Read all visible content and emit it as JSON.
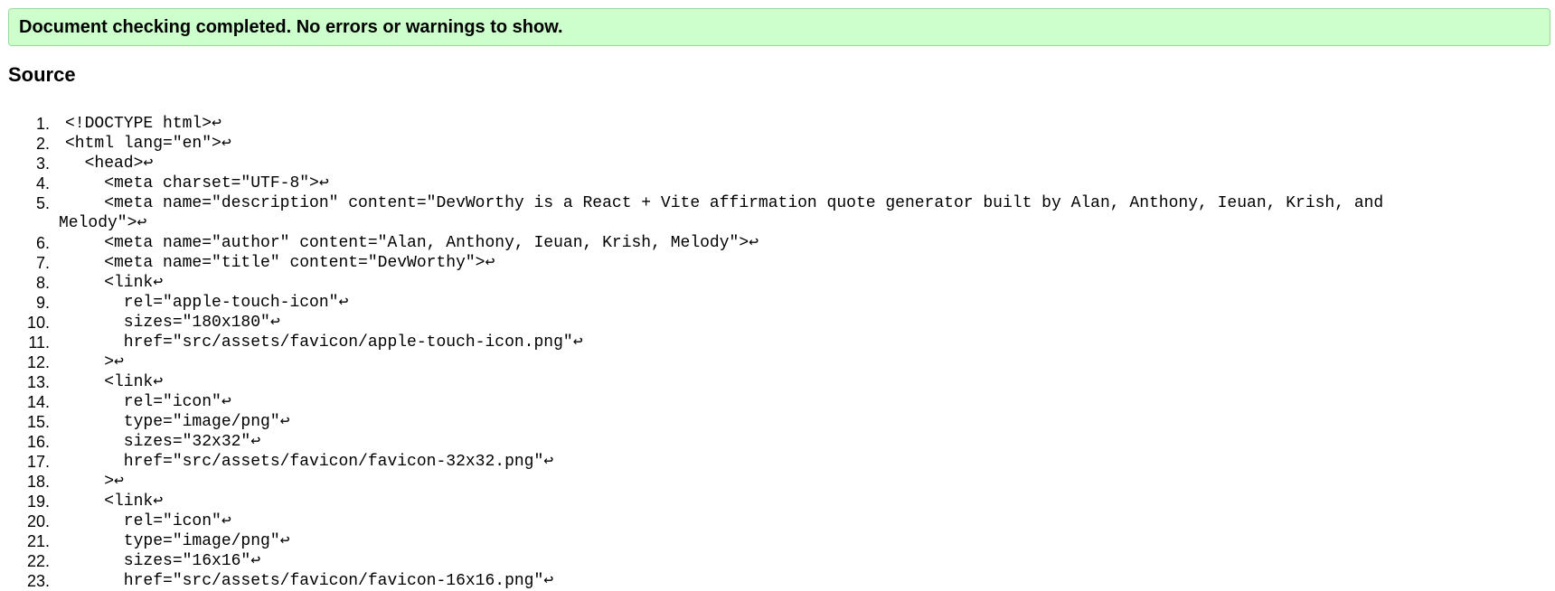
{
  "status": {
    "message": "Document checking completed. No errors or warnings to show."
  },
  "source": {
    "heading": "Source",
    "lines": [
      {
        "number": "1.",
        "code": "<!DOCTYPE html>↩"
      },
      {
        "number": "2.",
        "code": "<html lang=\"en\">↩"
      },
      {
        "number": "3.",
        "code": "  <head>↩"
      },
      {
        "number": "4.",
        "code": "    <meta charset=\"UTF-8\">↩"
      },
      {
        "number": "5.",
        "code": "    <meta name=\"description\" content=\"DevWorthy is a React + Vite affirmation quote generator built by Alan, Anthony, Ieuan, Krish, and",
        "continuation": "Melody\">↩"
      },
      {
        "number": "6.",
        "code": "    <meta name=\"author\" content=\"Alan, Anthony, Ieuan, Krish, Melody\">↩"
      },
      {
        "number": "7.",
        "code": "    <meta name=\"title\" content=\"DevWorthy\">↩"
      },
      {
        "number": "8.",
        "code": "    <link↩"
      },
      {
        "number": "9.",
        "code": "      rel=\"apple-touch-icon\"↩"
      },
      {
        "number": "10.",
        "code": "      sizes=\"180x180\"↩"
      },
      {
        "number": "11.",
        "code": "      href=\"src/assets/favicon/apple-touch-icon.png\"↩"
      },
      {
        "number": "12.",
        "code": "    >↩"
      },
      {
        "number": "13.",
        "code": "    <link↩"
      },
      {
        "number": "14.",
        "code": "      rel=\"icon\"↩"
      },
      {
        "number": "15.",
        "code": "      type=\"image/png\"↩"
      },
      {
        "number": "16.",
        "code": "      sizes=\"32x32\"↩"
      },
      {
        "number": "17.",
        "code": "      href=\"src/assets/favicon/favicon-32x32.png\"↩"
      },
      {
        "number": "18.",
        "code": "    >↩"
      },
      {
        "number": "19.",
        "code": "    <link↩"
      },
      {
        "number": "20.",
        "code": "      rel=\"icon\"↩"
      },
      {
        "number": "21.",
        "code": "      type=\"image/png\"↩"
      },
      {
        "number": "22.",
        "code": "      sizes=\"16x16\"↩"
      },
      {
        "number": "23.",
        "code": "      href=\"src/assets/favicon/favicon-16x16.png\"↩"
      }
    ]
  }
}
